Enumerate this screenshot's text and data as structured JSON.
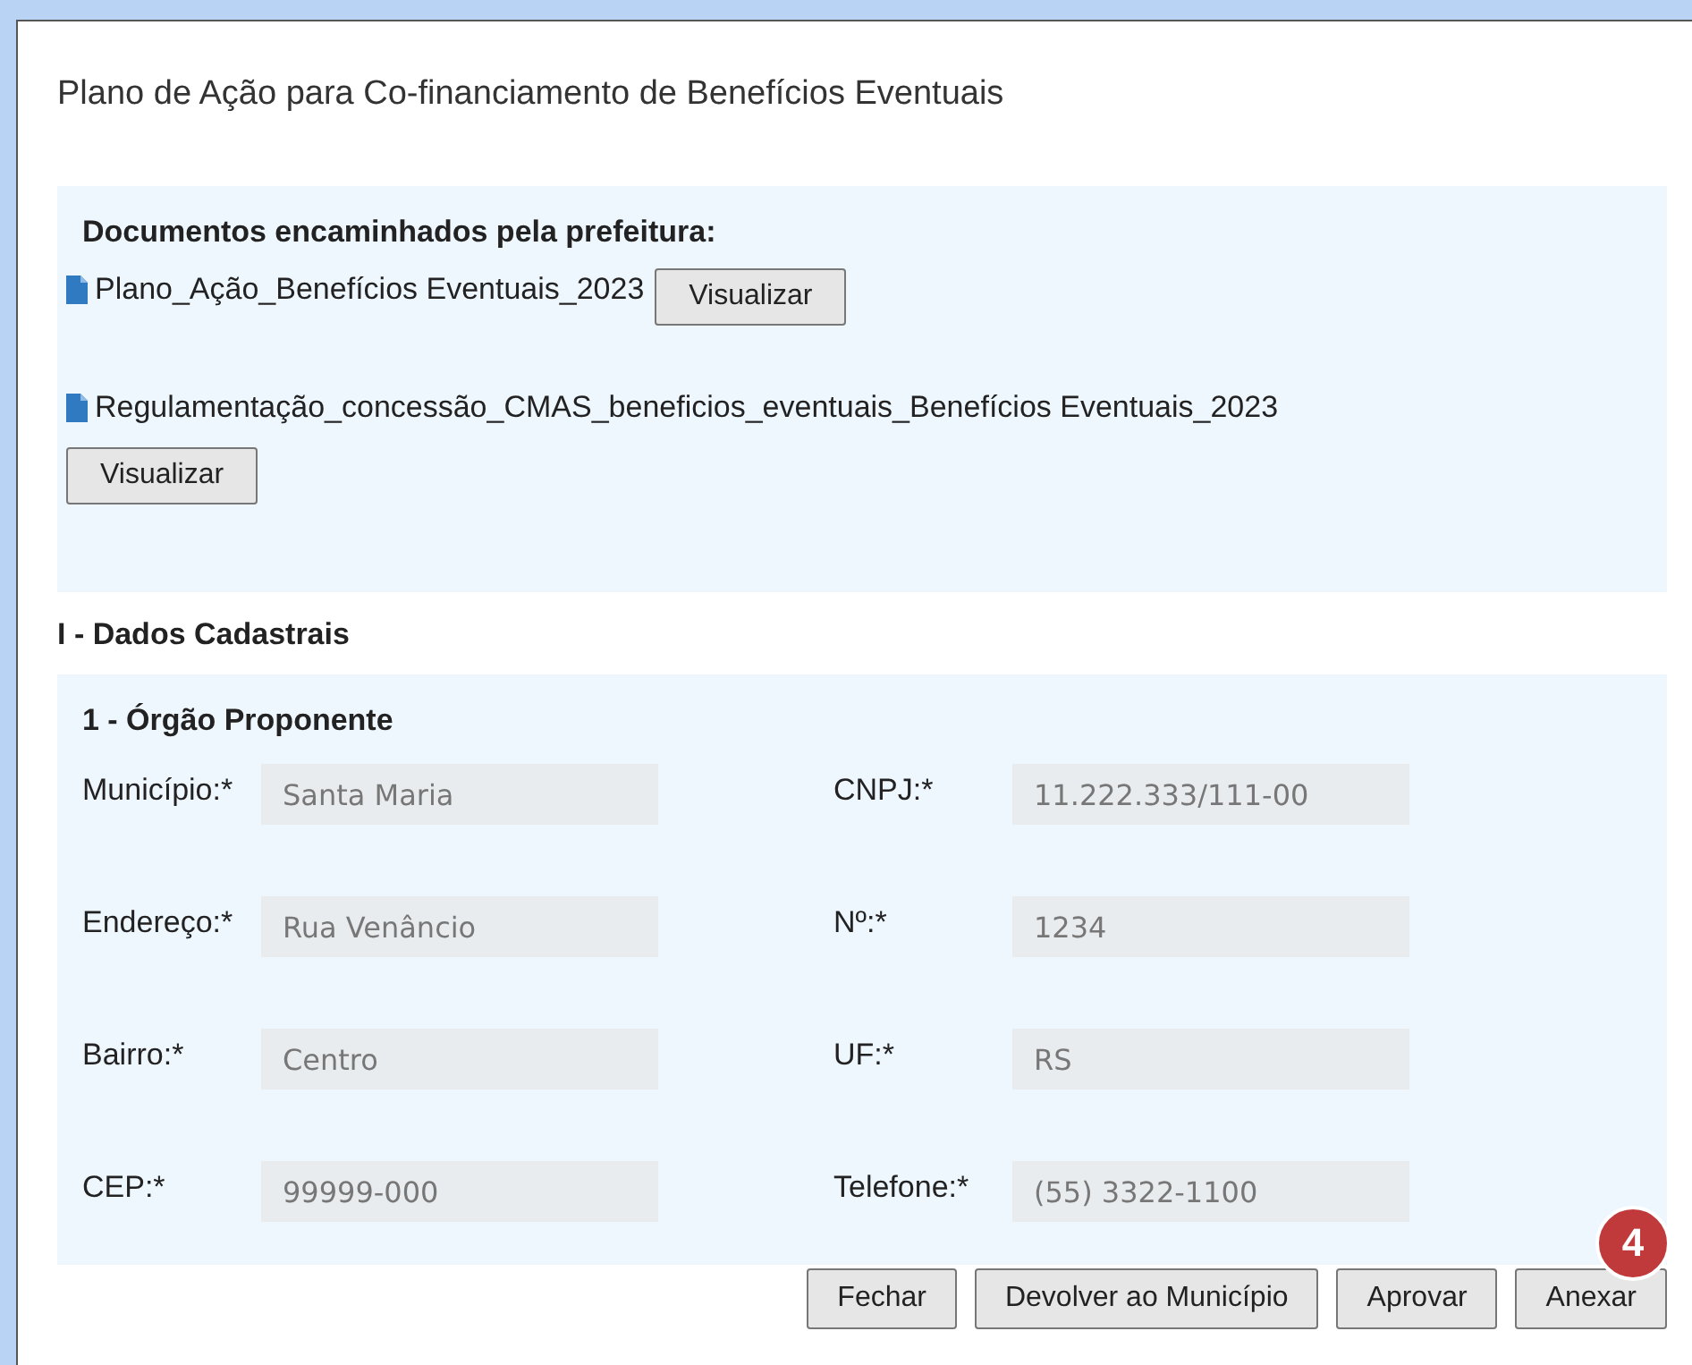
{
  "title": "Plano de Ação para Co-financiamento de Benefícios Eventuais",
  "documents": {
    "heading": "Documentos encaminhados pela prefeitura:",
    "items": [
      {
        "name": "Plano_Ação_Benefícios Eventuais_2023",
        "button": "Visualizar"
      },
      {
        "name": "Regulamentação_concessão_CMAS_beneficios_eventuais_Benefícios Eventuais_2023",
        "button": "Visualizar"
      }
    ]
  },
  "section": {
    "title": "I - Dados Cadastrais",
    "subtitle": "1 - Órgão Proponente",
    "fields": [
      {
        "label": "Município:*",
        "value": "Santa Maria",
        "disabled": true
      },
      {
        "label": "CNPJ:*",
        "value": "11.222.333/111-00",
        "disabled": true
      },
      {
        "label": "Endereço:*",
        "value": "Rua Venâncio",
        "disabled": true
      },
      {
        "label": "Nº:*",
        "value": "1234",
        "disabled": true
      },
      {
        "label": "Bairro:*",
        "value": "Centro",
        "disabled": true
      },
      {
        "label": "UF:*",
        "value": "RS",
        "disabled": true
      },
      {
        "label": "CEP:*",
        "value": "99999-000",
        "disabled": true
      },
      {
        "label": "Telefone:*",
        "value": "(55) 3322-1100",
        "disabled": true
      }
    ]
  },
  "buttons": [
    "Fechar",
    "Devolver ao Município",
    "Aprovar",
    "Anexar"
  ],
  "badge": "4"
}
